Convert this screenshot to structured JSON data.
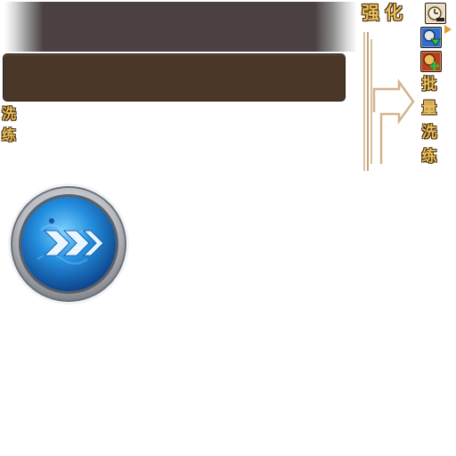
{
  "header": {
    "title": "强化",
    "left_label": [
      "洗",
      "练"
    ],
    "side_label": [
      "批",
      "量",
      "洗",
      "练"
    ]
  },
  "icons": {
    "top": "enhance-clock-minus-icon",
    "middle": "blue-arrow-down-icon",
    "bottom": "red-plus-icon",
    "pointer": "triangle-right-icon"
  },
  "action_button": {
    "icon": "double-chevron-right-icon",
    "colors": {
      "outer_ring": "#c9ccd1",
      "inner": "#1f7fd6",
      "chevron": "#e8f6ff"
    }
  },
  "colors": {
    "gold_text": "#e8c060",
    "panel": "#4a3727",
    "banner": "#4b4140"
  }
}
